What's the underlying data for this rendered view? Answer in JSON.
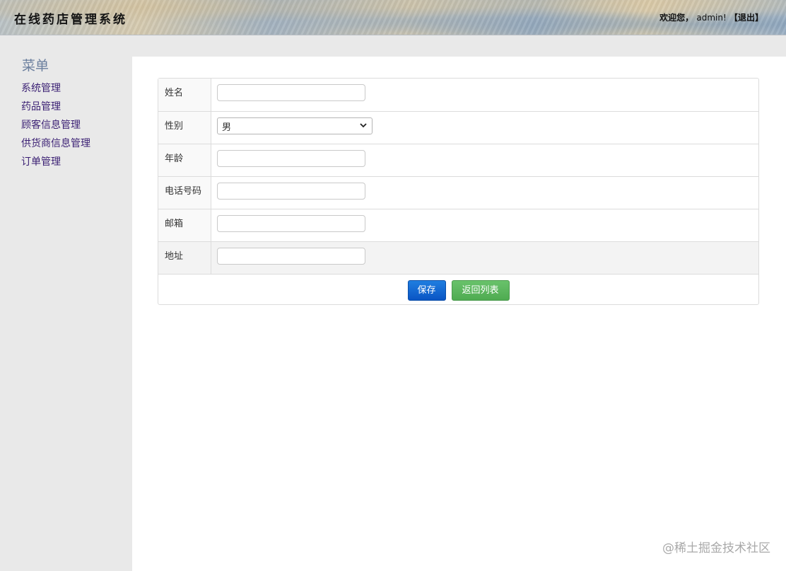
{
  "header": {
    "title": "在线药店管理系统",
    "welcome_prefix": "欢迎您，",
    "username": "admin!",
    "logout": "【退出】"
  },
  "sidebar": {
    "title": "菜单",
    "items": [
      {
        "label": "系统管理"
      },
      {
        "label": "药品管理"
      },
      {
        "label": "顾客信息管理"
      },
      {
        "label": "供货商信息管理"
      },
      {
        "label": "订单管理"
      }
    ]
  },
  "form": {
    "fields": [
      {
        "label": "姓名",
        "value": "",
        "type": "text"
      },
      {
        "label": "性别",
        "value": "男",
        "type": "select"
      },
      {
        "label": "年龄",
        "value": "",
        "type": "text"
      },
      {
        "label": "电话号码",
        "value": "",
        "type": "text"
      },
      {
        "label": "邮箱",
        "value": "",
        "type": "text"
      },
      {
        "label": "地址",
        "value": "",
        "type": "text"
      }
    ],
    "save_label": "保存",
    "back_label": "返回列表"
  },
  "watermark": "@稀土掘金技术社区",
  "colors": {
    "sidebar_link": "#3a1f73",
    "save_button": "#0a55c4",
    "back_button": "#4fab51"
  }
}
